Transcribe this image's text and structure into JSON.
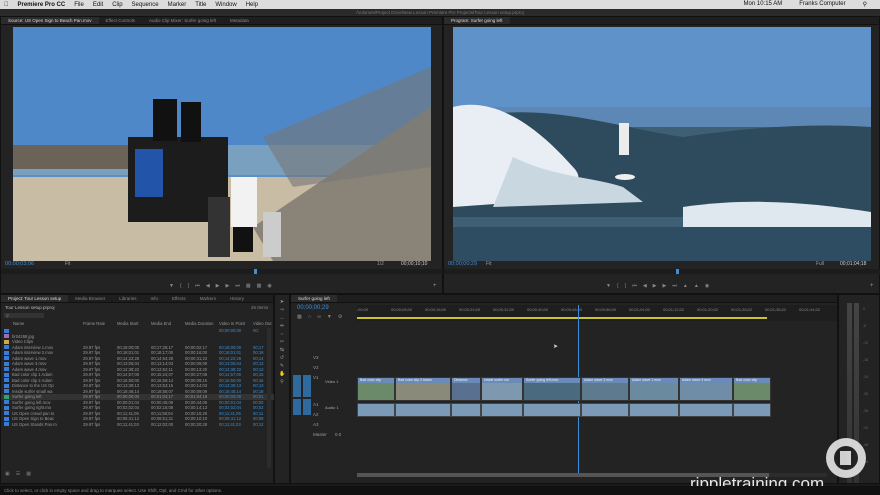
{
  "menubar": {
    "apple": "",
    "app": "Premiere Pro CC",
    "items": [
      "File",
      "Edit",
      "Clip",
      "Sequence",
      "Marker",
      "Title",
      "Window",
      "Help"
    ],
    "clock": "Mon 10:15 AM",
    "user": "Franks Computer"
  },
  "window_title": "/Volumes/Project Drive/New Lesson Premiere Pro Projects/Tour Lesson setup.prproj",
  "source": {
    "tabs": [
      "Source: US Open Sign to Beach Pan.mov",
      "Effect Controls",
      "Audio Clip Mixer: Surfer going left",
      "Metadata"
    ],
    "timecode": "00;00;03;06",
    "fit": "Fit",
    "res": "1/2",
    "duration": "00;00;10;10"
  },
  "program": {
    "tab": "Program: Surfer going left",
    "timecode": "00;00;00;29",
    "fit": "Fit",
    "res": "Full",
    "duration": "00;01;04;18"
  },
  "project": {
    "tabs": [
      "Project: Tour Lesson setup",
      "Media Browser",
      "Libraries",
      "Info",
      "Effects",
      "Markers",
      "History"
    ],
    "file": "Tour Lesson setup.prproj",
    "items_count": "26 Items",
    "headers": [
      "Name",
      "Frame Rate",
      "Media Start",
      "Media End",
      "Media Duration",
      "Video In Point",
      "Video Out"
    ],
    "rows": [
      [
        "",
        "",
        "",
        "",
        "",
        "00;00;00;00",
        "00;"
      ],
      [
        "br04268.jpg",
        "",
        "",
        "",
        "",
        "",
        ""
      ],
      [
        "Video Clips",
        "",
        "",
        "",
        "",
        "",
        ""
      ],
      [
        "Adam interview 1.mov",
        "29.97 fps",
        "00;18;00;00",
        "00;17;28;17",
        "00;00;02;17",
        "00;18;00;00",
        "00;17"
      ],
      [
        "Adam interview 2.mov",
        "29.97 fps",
        "00;18;01;01",
        "00;18;17;00",
        "00;00;16;00",
        "00;18;01;01",
        "00;18"
      ],
      [
        "Adam wave 1.mov",
        "29.97 fps",
        "00;14;22;26",
        "00;14;54;28",
        "00;00;31;23",
        "00;14;22;26",
        "00;14"
      ],
      [
        "Adam wave 3.mov",
        "29.97 fps",
        "00;13;05;04",
        "00;13;14;03",
        "00;00;08;09",
        "00;13;05;04",
        "00;13"
      ],
      [
        "Adam wave 4.mov",
        "29.97 fps",
        "00;12;38;22",
        "00;12;52;11",
        "00;00;13;20",
        "00;12;38;22",
        "00;12"
      ],
      [
        "Bad color clip 1 Adam",
        "29.97 fps",
        "00;14;57;00",
        "00;15;24;07",
        "00;00;27;08",
        "00;14;57;00",
        "00;15"
      ],
      [
        "Bad color clip 2 Adam",
        "29.97 fps",
        "00;16;50;00",
        "00;16;59;14",
        "00;00;09;15",
        "00;16;50;00",
        "00;16"
      ],
      [
        "Distance to the US Op",
        "29.97 fps",
        "00;13;39;13",
        "00;13;53;15",
        "00;00;14;03",
        "00;13;39;13",
        "00;13"
      ],
      [
        "Inside surfer small wa",
        "29.97 fps",
        "00;18;48;14",
        "00;18;58;07",
        "00;00;09;09",
        "00;18;48;14",
        "00;18"
      ],
      [
        "Surfer going left",
        "29.97 fps",
        "00;00;00;00",
        "00;01;04;17",
        "00;01;04;18",
        "00;00;00;00",
        "00;01"
      ],
      [
        "Surfer going left.mov",
        "29.97 fps",
        "00;00;01;04",
        "00;00;45;09",
        "00;00;44;06",
        "00;00;01;04",
        "00;00"
      ],
      [
        "Surfer going right.mo",
        "29.97 fps",
        "00;02;02;04",
        "00;02;16;08",
        "00;00;14;13",
        "00;02;02;04",
        "00;02"
      ],
      [
        "US Open crowd pan to",
        "29.97 fps",
        "00;11;41;06",
        "00;11;58;04",
        "00;00;16;29",
        "00;11;41;06",
        "00;11"
      ],
      [
        "US Open Sign to Beac",
        "29.97 fps",
        "00;08;41;12",
        "00;08;51;21",
        "00;00;10;10",
        "00;08;41;12",
        "00;08"
      ],
      [
        "US Open Stands Pan.m",
        "29.97 fps",
        "00;11;41;03",
        "00;12;02;00",
        "00;00;20;28",
        "00;11;41;03",
        "00;12"
      ]
    ],
    "swatches": [
      "#3a7bd5",
      "#9a6fb0",
      "#cfa84a",
      "#3a7bd5",
      "#3a7bd5",
      "#3a7bd5",
      "#3a7bd5",
      "#3a7bd5",
      "#3a7bd5",
      "#3a7bd5",
      "#3a7bd5",
      "#3a7bd5",
      "#3aa06a",
      "#3a7bd5",
      "#3a7bd5",
      "#3a7bd5",
      "#3a7bd5",
      "#3a7bd5"
    ]
  },
  "timeline": {
    "tab": "Surfer going left",
    "timecode": "00;00;00;29",
    "ruler": [
      ";00;00",
      "00;00;08;00",
      "00;00;16;00",
      "00;00;24;00",
      "00;00;32;00",
      "00;00;40;00",
      "00;00;48;00",
      "00;00;56;00",
      "00;01;04;02",
      "00;01;12;02",
      "00;01;20;02",
      "00;01;28;02",
      "00;01;36;02",
      "00;01;44;02"
    ],
    "tracks": [
      "V3",
      "V2",
      "V1",
      "A1",
      "A2",
      "A3",
      "Master"
    ],
    "v1_label": "Video 1",
    "a1_label": "Audio 1",
    "master_value": "0.0",
    "clips": [
      "Bad color clip",
      "Bad color clip 2 Adam",
      "Distance",
      "Inside surfer sm",
      "Surfer going left.mov",
      "Adam wave 3 mov",
      "Adam wave 1 mov",
      "Adam wave 4 mov",
      "Bad color clip"
    ]
  },
  "status": "Click to select, or click in empty space and drag to marquee select. Use Shift, Opt, and Cmd for other options.",
  "watermark": "rippletraining.com",
  "meter_db": [
    "0",
    "-6",
    "-12",
    "-18",
    "-24",
    "-30",
    "-36",
    "-42",
    "-48",
    "-54"
  ]
}
